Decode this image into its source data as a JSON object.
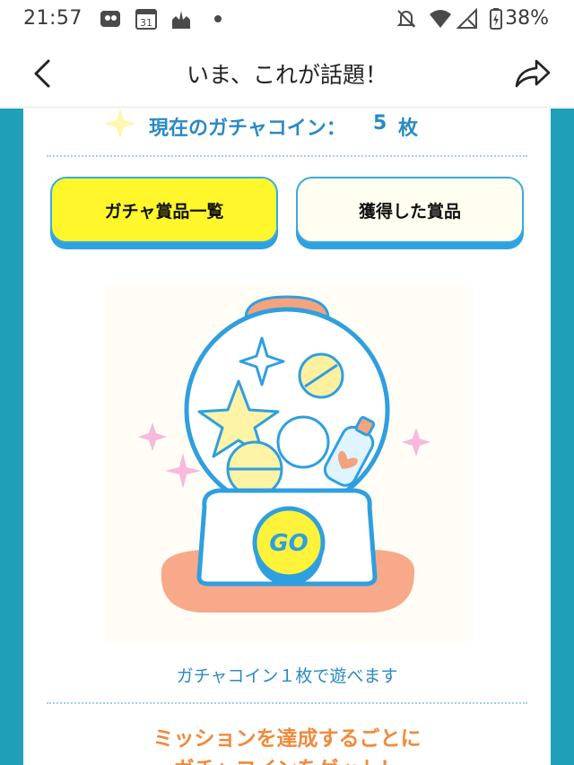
{
  "status_bar": {
    "time": "21:57",
    "calendar_day": "31",
    "battery_percent": "38%",
    "icons": [
      "ticket-icon",
      "calendar-icon",
      "castle-icon",
      "dot-icon",
      "bell-off-icon",
      "wifi-icon",
      "signal-icon",
      "battery-icon"
    ]
  },
  "header": {
    "title": "いま、これが話題！",
    "back_icon": "chevron-left-icon",
    "share_icon": "share-arrow-icon"
  },
  "coins": {
    "label": "現在のガチャコイン：",
    "count": "5",
    "unit": "枚"
  },
  "buttons": {
    "prize_list": "ガチャ賞品一覧",
    "won_prizes": "獲得した賞品"
  },
  "gacha": {
    "go_label": "GO"
  },
  "play_note": "ガチャコイン１枚で遊べます",
  "mission": {
    "line1": "ミッションを達成するごとに",
    "line2": "ガチャコインをゲット！"
  },
  "colors": {
    "frame": "#1fa0b8",
    "accent_blue": "#2b8ac4",
    "button_yellow": "#fff72b",
    "mission_orange": "#f08a3c"
  }
}
